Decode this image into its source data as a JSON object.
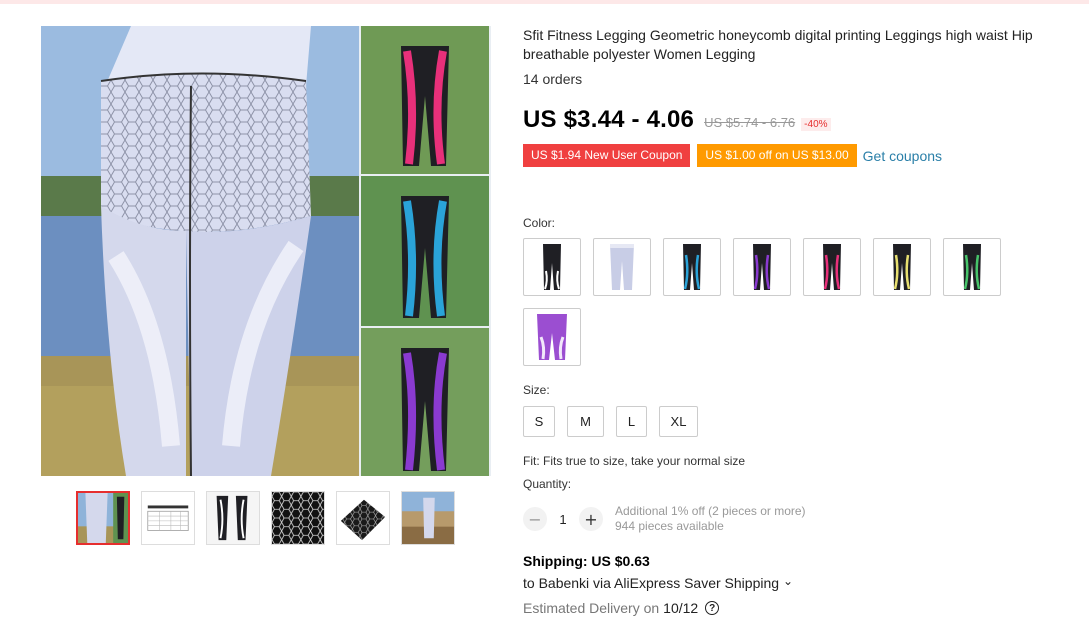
{
  "product": {
    "title": "Sfit Fitness Legging Geometric honeycomb digital printing Leggings high waist Hip breathable polyester Women Legging",
    "orders": "14 orders"
  },
  "price": {
    "current": "US $3.44 - 4.06",
    "original": "US $5.74 - 6.76",
    "discount": "-40%"
  },
  "coupons": {
    "new_user": "US $1.94 New User Coupon",
    "store": "US $1.00 off on US $13.00",
    "get_link": "Get coupons"
  },
  "colors": {
    "label": "Color:",
    "options": [
      {
        "name": "black-white",
        "accent": "#ffffff"
      },
      {
        "name": "white-honeycomb",
        "accent": "#c8cde6"
      },
      {
        "name": "black-blue",
        "accent": "#2aa3d8"
      },
      {
        "name": "black-purple",
        "accent": "#8a3ad0"
      },
      {
        "name": "black-pink",
        "accent": "#e8307a"
      },
      {
        "name": "black-yellow",
        "accent": "#e8e070"
      },
      {
        "name": "black-green",
        "accent": "#47c46a"
      },
      {
        "name": "purple-white",
        "accent": "#9b4ed1"
      }
    ]
  },
  "sizes": {
    "label": "Size:",
    "options": [
      "S",
      "M",
      "L",
      "XL"
    ]
  },
  "fit": "Fit: Fits true to size, take your normal size",
  "quantity": {
    "label": "Quantity:",
    "value": "1",
    "minus": "−",
    "plus": "+",
    "additional": "Additional 1% off (2 pieces or more)",
    "available": "944 pieces available"
  },
  "shipping": {
    "cost": "Shipping: US $0.63",
    "to": "to Babenki via AliExpress Saver Shipping",
    "chevron": "⌄",
    "delivery_prefix": "Estimated Delivery on",
    "delivery_date": "10/12",
    "help": "?"
  },
  "icons": {
    "help": "question-circle-icon",
    "chevron": "chevron-down-icon"
  },
  "colors_theme": {
    "accent_red": "#f04040",
    "accent_orange": "#ff9a00",
    "link_blue": "#2a7fa8"
  }
}
